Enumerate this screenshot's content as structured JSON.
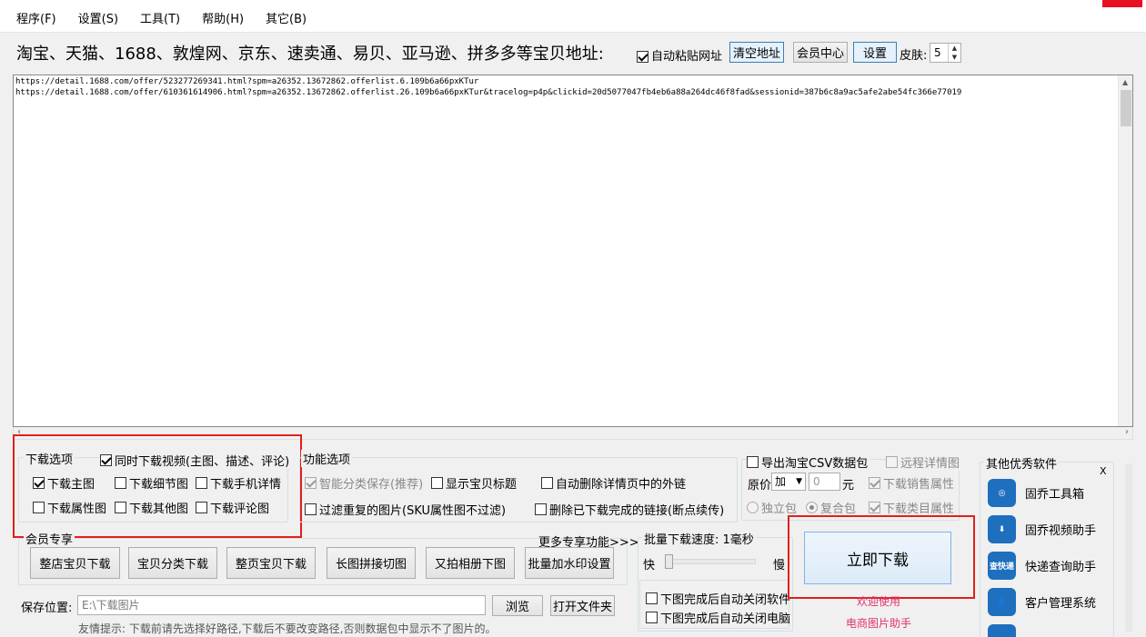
{
  "menu": [
    {
      "label": "程序(F)"
    },
    {
      "label": "设置(S)"
    },
    {
      "label": "工具(T)"
    },
    {
      "label": "帮助(H)"
    },
    {
      "label": "其它(B)"
    }
  ],
  "header": {
    "address_label": "淘宝、天猫、1688、敦煌网、京东、速卖通、易贝、亚马逊、拼多多等宝贝地址:",
    "auto_paste_label": "自动粘贴网址",
    "clear_button": "清空地址",
    "member_button": "会员中心",
    "settings_button": "设置",
    "skin_label": "皮肤:",
    "skin_value": "5"
  },
  "urls": [
    "https://detail.1688.com/offer/523277269341.html?spm=a26352.13672862.offerlist.6.109b6a66pxKTur",
    "https://detail.1688.com/offer/610361614906.html?spm=a26352.13672862.offerlist.26.109b6a66pxKTur&tracelog=p4p&clickid=20d5077047fb4eb6a88a264dc46f8fad&sessionid=387b6c8a9ac5afe2abe54fc366e77019"
  ],
  "download_options": {
    "title": "下载选项",
    "video_label": "同时下载视频(主图、描述、评论)",
    "main_image": "下载主图",
    "detail_image": "下载细节图",
    "mobile_detail": "下载手机详情",
    "attr_image": "下载属性图",
    "other_image": "下载其他图",
    "review_image": "下载评论图"
  },
  "function_options": {
    "title": "功能选项",
    "smart_save": "智能分类保存(推荐)",
    "show_title": "显示宝贝标题",
    "auto_delete_links": "自动删除详情页中的外链",
    "filter_dup": "过滤重复的图片(SKU属性图不过滤)",
    "delete_done_links": "删除已下载完成的链接(断点续传)"
  },
  "csv_options": {
    "export_csv": "导出淘宝CSV数据包",
    "remote_detail": "远程详情图",
    "price_label": "原价",
    "price_op": "加",
    "price_value": "0",
    "unit": "元",
    "sales_attr": "下载销售属性",
    "single_pack": "独立包",
    "combined_pack": "复合包",
    "category_attr": "下载类目属性"
  },
  "member": {
    "title": "会员专享",
    "more": "更多专享功能>>>",
    "buttons": [
      "整店宝贝下载",
      "宝贝分类下载",
      "整页宝贝下载",
      "长图拼接切图",
      "又拍相册下图",
      "批量加水印设置"
    ]
  },
  "speed": {
    "title": "批量下载速度: 1毫秒",
    "fast": "快",
    "slow": "慢",
    "close_app": "下图完成后自动关闭软件",
    "shutdown": "下图完成后自动关闭电脑"
  },
  "download_now": "立即下载",
  "welcome_line1": "欢迎使用",
  "welcome_line2": "电商图片助手",
  "save": {
    "label": "保存位置:",
    "path": "E:\\下载图片",
    "browse": "浏览",
    "open_folder": "打开文件夹",
    "tip": "友情提示: 下载前请先选择好路径,下载后不要改变路径,否则数据包中显示不了图片的。"
  },
  "other_software": {
    "title": "其他优秀软件",
    "close": "X",
    "items": [
      {
        "label": "固乔工具箱",
        "icon": "toolbox-icon",
        "icon_text": "◎"
      },
      {
        "label": "固乔视频助手",
        "icon": "video-download-icon",
        "icon_text": "⬇"
      },
      {
        "label": "快递查询助手",
        "icon": "express-query-icon",
        "icon_text": "查快递"
      },
      {
        "label": "客户管理系统",
        "icon": "customer-icon",
        "icon_text": "👤"
      }
    ]
  },
  "colors": {
    "accent_red": "#e0201c",
    "pink_text": "#e3306a",
    "app_icon_blue": "#1f6fbf"
  }
}
